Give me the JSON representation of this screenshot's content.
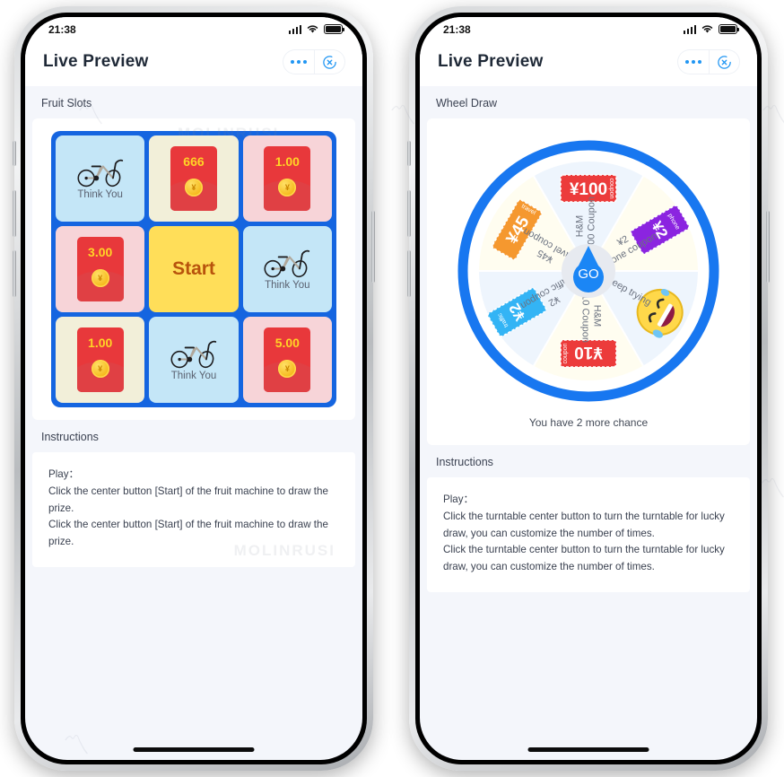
{
  "app": {
    "title": "Live Preview",
    "status_time": "21:38",
    "more_icon": "ellipsis-icon",
    "close_icon": "close-circle-icon"
  },
  "left_phone": {
    "section_label": "Fruit Slots",
    "instructions_label": "Instructions",
    "instructions_text": "Play：\nClick the center button [Start] of the fruit machine to draw the prize.\nClick the center button [Start] of the fruit machine to draw the prize.",
    "start_label": "Start",
    "slots": [
      {
        "type": "bike",
        "label": "Think You",
        "bg": "#c4e6f7"
      },
      {
        "type": "env",
        "amount": "666",
        "bg": "#f2efd9"
      },
      {
        "type": "env",
        "amount": "1.00",
        "bg": "#f7d4d8"
      },
      {
        "type": "env",
        "amount": "3.00",
        "bg": "#f7d4d8"
      },
      {
        "type": "start",
        "label": "Start",
        "bg": "#ffde59"
      },
      {
        "type": "bike",
        "label": "Think You",
        "bg": "#c4e6f7"
      },
      {
        "type": "env",
        "amount": "1.00",
        "bg": "#f2efd9"
      },
      {
        "type": "bike",
        "label": "Think You",
        "bg": "#c4e6f7"
      },
      {
        "type": "env",
        "amount": "5.00",
        "bg": "#f7d4d8"
      }
    ]
  },
  "right_phone": {
    "section_label": "Wheel Draw",
    "instructions_label": "Instructions",
    "instructions_text": "Play：\nClick the turntable center button to turn the turntable for lucky draw, you can customize the number of times.\nClick the turntable center button to turn the turntable for lucky draw, you can customize the number of times.",
    "go_label": "GO",
    "chance_text": "You have 2 more chance",
    "chance_count": "2",
    "wheel": {
      "rim_color": "#1877f0",
      "segments": [
        {
          "label": "¥45\nTravel coupon",
          "bg": "#fffdf0",
          "ticket_color": "#f5982f",
          "ticket_amount": "¥45",
          "ticket_tag": "travel",
          "angle": -60
        },
        {
          "label": "H&M\n¥100 Coupon",
          "bg": "#eef5fd",
          "ticket_color": "#ec3b3b",
          "ticket_amount": "¥100",
          "ticket_tag": "coupon",
          "angle": 0
        },
        {
          "label": "¥2\nPhone coupon",
          "bg": "#fffdf0",
          "ticket_color": "#8b24e0",
          "ticket_amount": "¥2",
          "ticket_tag": "phone",
          "angle": 60
        },
        {
          "label": "Keep trying",
          "bg": "#eef5fd",
          "ticket_color": "#ffd84a",
          "ticket_amount": "",
          "ticket_tag": "emoji",
          "angle": 120
        },
        {
          "label": "H&M\n¥10 Coupon",
          "bg": "#fffdf0",
          "ticket_color": "#ec3b3b",
          "ticket_amount": "¥10",
          "ticket_tag": "coupon",
          "angle": 180
        },
        {
          "label": "¥2\nTraffic coupon",
          "bg": "#eef5fd",
          "ticket_color": "#33b4f5",
          "ticket_amount": "¥2",
          "ticket_tag": "traffic",
          "angle": 240
        }
      ]
    }
  },
  "watermark": "MOLINRUSI"
}
